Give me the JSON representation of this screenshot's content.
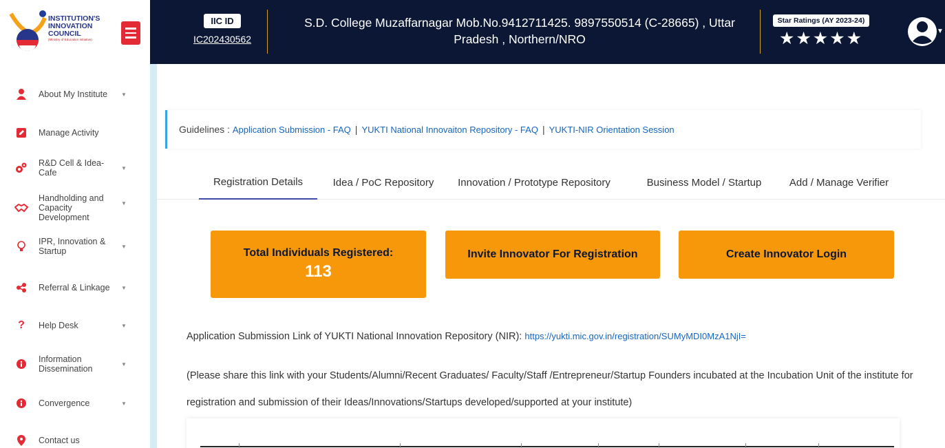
{
  "header": {
    "logo": {
      "line1": "INSTITUTION'S",
      "line2": "INNOVATION",
      "line3": "COUNCIL",
      "sub": "(Ministry of Education Initiative)"
    },
    "iic_label": "IIC ID",
    "iic_value": "IC202430562",
    "institution_line1": "S.D. College Muzaffarnagar Mob.No.9412711425. 9897550514 (C-28665) , Uttar",
    "institution_line2": "Pradesh , Northern/NRO",
    "star_label": "Star Ratings (AY 2023-24)",
    "stars": "★★★★★",
    "star_count": 5
  },
  "sidebar": {
    "items": [
      {
        "label": "About My Institute",
        "icon": "user-icon",
        "has_caret": true
      },
      {
        "label": "Manage Activity",
        "icon": "edit-icon",
        "has_caret": false
      },
      {
        "label": "R&D Cell & Idea-Cafe",
        "icon": "cogs-icon",
        "has_caret": true
      },
      {
        "label": "Handholding and Capacity Development",
        "icon": "handshake-icon",
        "has_caret": true
      },
      {
        "label": "IPR, Innovation & Startup",
        "icon": "lightbulb-icon",
        "has_caret": true
      },
      {
        "label": "Referral & Linkage",
        "icon": "share-icon",
        "has_caret": true
      },
      {
        "label": "Help Desk",
        "icon": "question-icon",
        "has_caret": true
      },
      {
        "label": "Information Dissemination",
        "icon": "info-icon",
        "has_caret": true
      },
      {
        "label": "Convergence",
        "icon": "info-icon",
        "has_caret": true
      },
      {
        "label": "Contact us",
        "icon": "map-marker-icon",
        "has_caret": false
      }
    ]
  },
  "guidelines": {
    "prefix": "Guidelines :",
    "links": [
      "Application Submission - FAQ",
      "YUKTI National Innovaiton Repository - FAQ",
      "YUKTI-NIR Orientation Session"
    ],
    "separator": "|"
  },
  "tabs": [
    {
      "label": "Registration Details",
      "active": true
    },
    {
      "label": "Idea / PoC Repository",
      "active": false
    },
    {
      "label": "Innovation / Prototype Repository",
      "active": false
    },
    {
      "label": "Business Model / Startup",
      "active": false
    },
    {
      "label": "Add / Manage Verifier",
      "active": false
    }
  ],
  "cards": {
    "total_title": "Total Individuals Registered:",
    "total_count": "113",
    "invite_label": "Invite Innovator For Registration",
    "create_label": "Create Innovator Login"
  },
  "application_link": {
    "prefix": "Application Submission Link of YUKTI National Innovation Repository (NIR):",
    "url": "https://yukti.mic.gov.in/registration/SUMyMDI0MzA1NjI="
  },
  "share_note": "(Please share this link with your Students/Alumni/Recent Graduates/ Faculty/Staff /Entrepreneur/Startup Founders incubated at the Incubation Unit of the institute for registration and submission of their Ideas/Innovations/Startups developed/supported at your institute)",
  "colors": {
    "header_bg": "#0b1734",
    "orange": "#f7980b",
    "link_blue": "#1565c0",
    "menu_red": "#e42b35",
    "active_tab": "#3d4aa6"
  }
}
